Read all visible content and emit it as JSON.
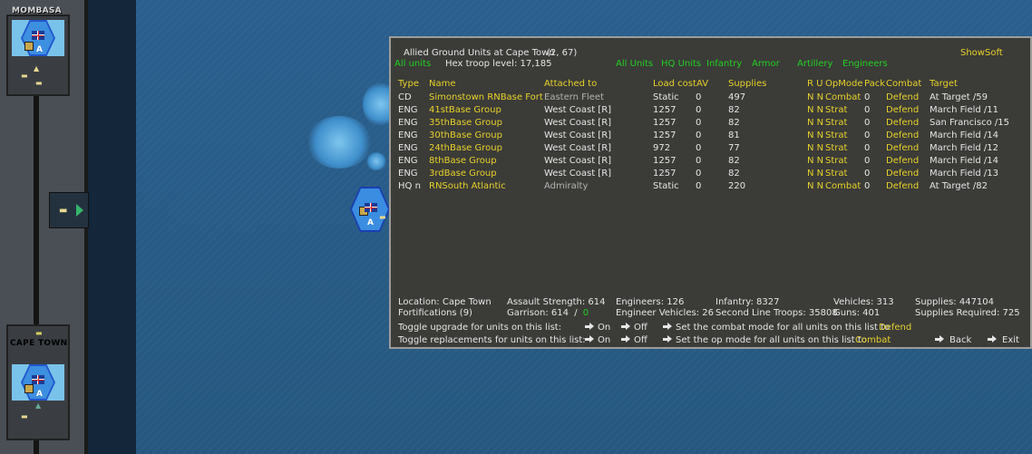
{
  "sidebar": {
    "cities": [
      {
        "name": "MOMBASA",
        "marker": "A"
      },
      {
        "name": "CAPE TOWN",
        "marker": "A"
      }
    ]
  },
  "map": {
    "hex_marker": "A"
  },
  "dialog": {
    "title": "Allied Ground Units at Cape Town",
    "coords": "(2, 67)",
    "show_soft": "ShowSoft",
    "all_units_link": "All units",
    "hex_troop_level": "Hex troop level: 17,185",
    "filters": [
      "All Units",
      "HQ Units",
      "Infantry",
      "Armor",
      "Artillery",
      "Engineers"
    ],
    "columns": {
      "type": "Type",
      "name": "Name",
      "attached": "Attached to",
      "load_cost": "Load cost",
      "av": "AV",
      "supplies": "Supplies",
      "ru": "R U",
      "opmode": "OpMode",
      "pack": "Pack",
      "combat": "Combat",
      "target": "Target"
    },
    "units": [
      {
        "type": "CD",
        "name": "Simonstown RNBase Fort",
        "attached": "Eastern Fleet",
        "load_cost": "Static",
        "av": "0",
        "supplies": "497",
        "ru": "N N",
        "opmode": "Combat",
        "pack": "0",
        "combat": "Defend",
        "target": "At Target /59"
      },
      {
        "type": "ENG",
        "name": "41stBase Group",
        "attached": "West Coast [R]",
        "load_cost": "1257",
        "av": "0",
        "supplies": "82",
        "ru": "N N",
        "opmode": "Strat",
        "pack": "0",
        "combat": "Defend",
        "target": "March Field /11"
      },
      {
        "type": "ENG",
        "name": "35thBase Group",
        "attached": "West Coast [R]",
        "load_cost": "1257",
        "av": "0",
        "supplies": "82",
        "ru": "N N",
        "opmode": "Strat",
        "pack": "0",
        "combat": "Defend",
        "target": "San Francisco /15"
      },
      {
        "type": "ENG",
        "name": "30thBase Group",
        "attached": "West Coast [R]",
        "load_cost": "1257",
        "av": "0",
        "supplies": "81",
        "ru": "N N",
        "opmode": "Strat",
        "pack": "0",
        "combat": "Defend",
        "target": "March Field /14"
      },
      {
        "type": "ENG",
        "name": "24thBase Group",
        "attached": "West Coast [R]",
        "load_cost": "972",
        "av": "0",
        "supplies": "77",
        "ru": "N N",
        "opmode": "Strat",
        "pack": "0",
        "combat": "Defend",
        "target": "March Field /12"
      },
      {
        "type": "ENG",
        "name": "8thBase Group",
        "attached": "West Coast [R]",
        "load_cost": "1257",
        "av": "0",
        "supplies": "82",
        "ru": "N N",
        "opmode": "Strat",
        "pack": "0",
        "combat": "Defend",
        "target": "March Field /14"
      },
      {
        "type": "ENG",
        "name": "3rdBase Group",
        "attached": "West Coast [R]",
        "load_cost": "1257",
        "av": "0",
        "supplies": "82",
        "ru": "N N",
        "opmode": "Strat",
        "pack": "0",
        "combat": "Defend",
        "target": "March Field /13"
      },
      {
        "type": "HQ n",
        "name": "RNSouth Atlantic",
        "attached": "Admiralty",
        "load_cost": "Static",
        "av": "0",
        "supplies": "220",
        "ru": "N N",
        "opmode": "Combat",
        "pack": "0",
        "combat": "Defend",
        "target": "At Target /82"
      }
    ],
    "summary": {
      "location": "Location: Cape Town",
      "fortifications": "Fortifications (9)",
      "assault_strength": "Assault Strength: 614",
      "garrison_label": "Garrison: 614",
      "garrison_sep": "/",
      "garrison_value": "0",
      "engineers": "Engineers: 126",
      "engineer_vehicles": "Engineer Vehicles: 26",
      "infantry": "Infantry: 8327",
      "second_line": "Second Line Troops: 35808",
      "vehicles": "Vehicles: 313",
      "guns": "Guns: 401",
      "supplies": "Supplies: 447104",
      "supplies_required": "Supplies Required: 725"
    },
    "controls": {
      "toggle_upgrade": "Toggle upgrade for units on this list:",
      "toggle_replacements": "Toggle replacements for units on this list:",
      "on": "On",
      "off": "Off",
      "set_combat_mode": "Set the combat mode for all units on this list to",
      "combat_mode_value": "Defend",
      "set_op_mode": "Set the op mode for all units on this list to",
      "op_mode_value": "Combat",
      "back": "Back",
      "exit": "Exit"
    }
  }
}
